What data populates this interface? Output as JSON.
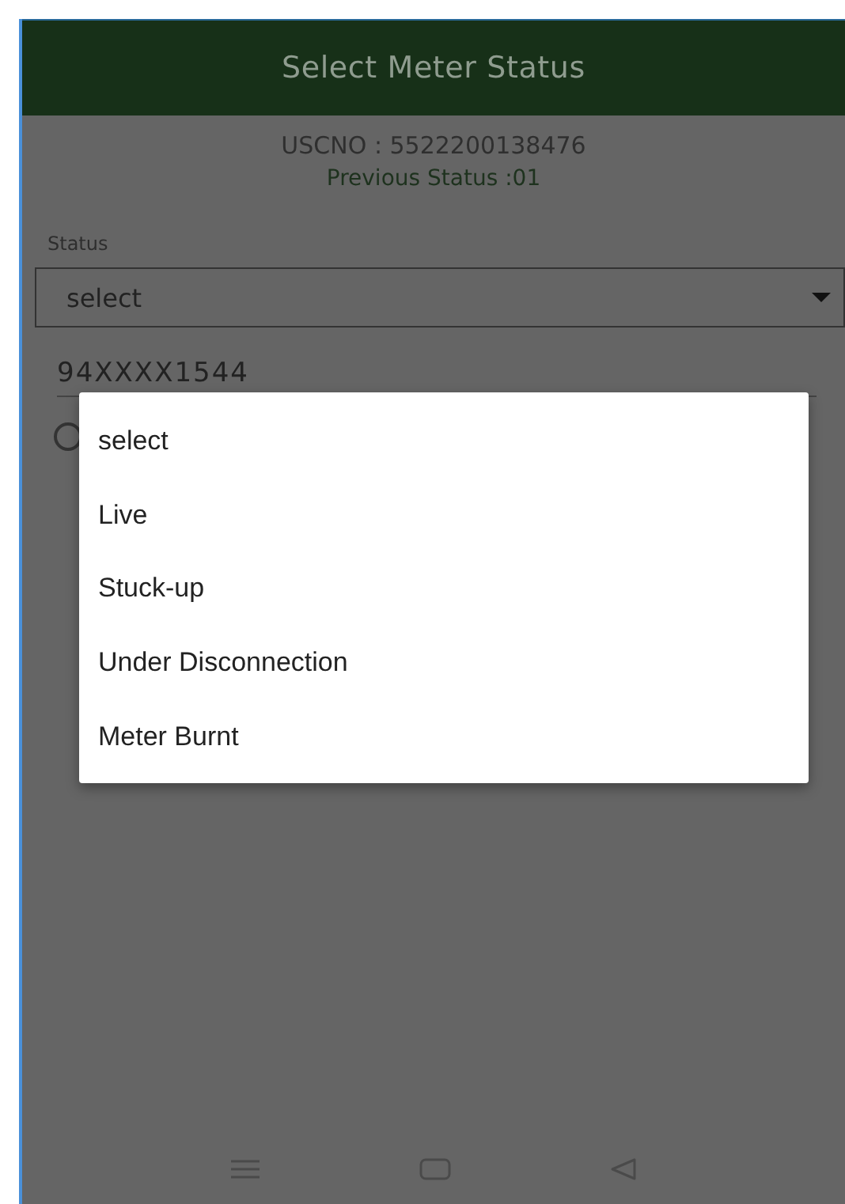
{
  "header": {
    "title": "Select Meter Status"
  },
  "info": {
    "uscno": "USCNO : 5522200138476",
    "previous_status": "Previous Status :01"
  },
  "status_field": {
    "label": "Status",
    "value": "select"
  },
  "phone_field": {
    "value": "94XXXX1544"
  },
  "radio": {
    "checked": false
  },
  "dropdown_menu": {
    "options": [
      {
        "label": "select"
      },
      {
        "label": "Live"
      },
      {
        "label": "Stuck-up"
      },
      {
        "label": "Under Disconnection"
      },
      {
        "label": "Meter Burnt"
      }
    ]
  }
}
